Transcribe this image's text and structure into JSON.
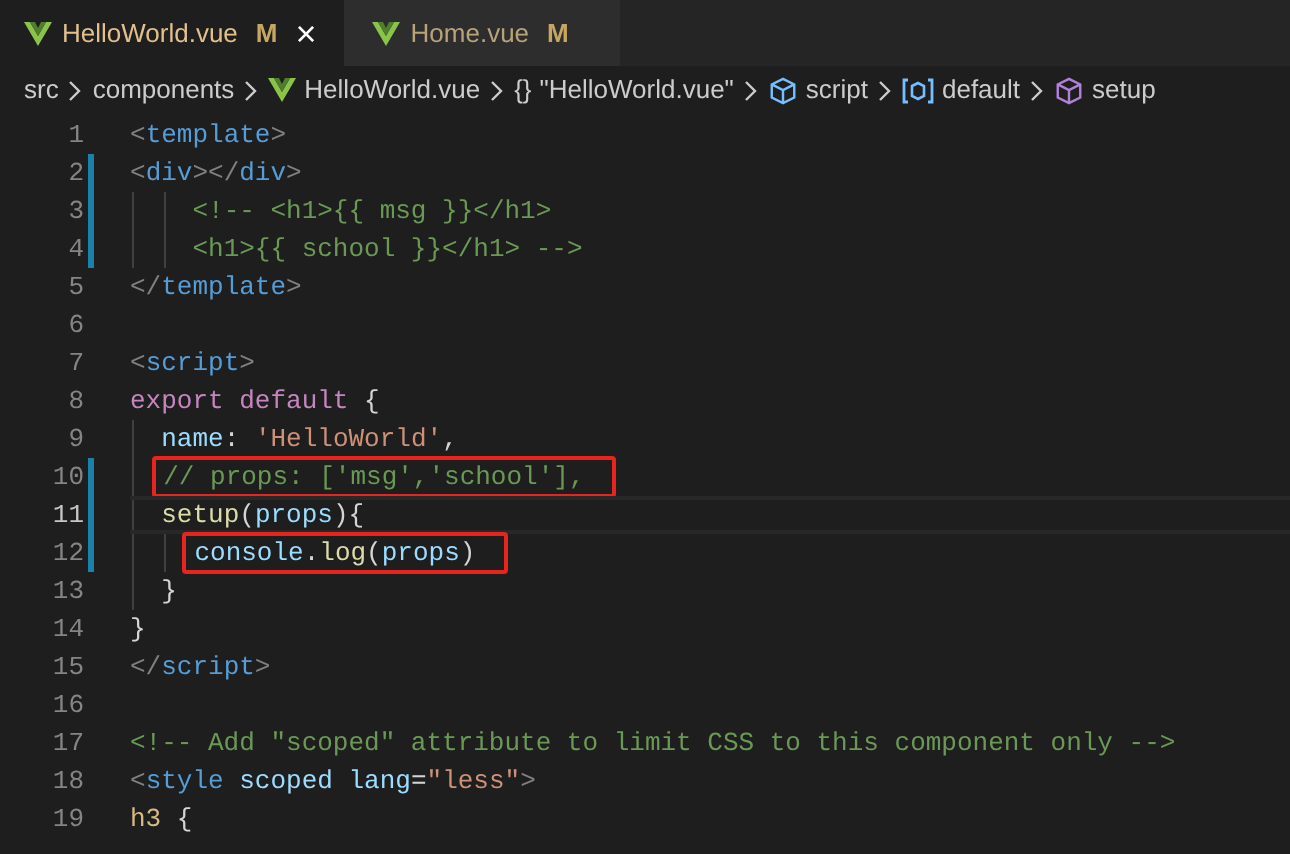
{
  "tabs": [
    {
      "label": "HelloWorld.vue",
      "badge": "M",
      "selected": true,
      "close": "×"
    },
    {
      "label": "Home.vue",
      "badge": "M",
      "selected": false
    }
  ],
  "breadcrumb": [
    {
      "label": "src"
    },
    {
      "label": "components"
    },
    {
      "label": "HelloWorld.vue",
      "kind": "vue"
    },
    {
      "label": "\"HelloWorld.vue\"",
      "kind": "braces",
      "glyph": "{}"
    },
    {
      "label": "script",
      "kind": "module"
    },
    {
      "label": "default",
      "kind": "field"
    },
    {
      "label": "setup",
      "kind": "method"
    }
  ],
  "editor": {
    "lines": [
      {
        "number": "1",
        "modified": false,
        "current": false,
        "boxed": false,
        "tokens": [
          {
            "text": "<",
            "kind": "punct"
          },
          {
            "text": "template",
            "kind": "tag"
          },
          {
            "text": ">",
            "kind": "punct"
          }
        ]
      },
      {
        "number": "2",
        "modified": true,
        "current": false,
        "boxed": false,
        "tokens": [
          {
            "text": "<",
            "kind": "punct"
          },
          {
            "text": "div",
            "kind": "tag"
          },
          {
            "text": "></",
            "kind": "punct"
          },
          {
            "text": "div",
            "kind": "tag"
          },
          {
            "text": ">",
            "kind": "punct"
          }
        ]
      },
      {
        "number": "3",
        "modified": true,
        "current": false,
        "boxed": false,
        "tokens": [
          {
            "text": "    <!-- <h1>{{ msg }}</h1>",
            "kind": "comment"
          }
        ]
      },
      {
        "number": "4",
        "modified": true,
        "current": false,
        "boxed": false,
        "tokens": [
          {
            "text": "    <h1>{{ school }}</h1> -->",
            "kind": "comment"
          }
        ]
      },
      {
        "number": "5",
        "modified": false,
        "current": false,
        "boxed": false,
        "tokens": [
          {
            "text": "</",
            "kind": "punct"
          },
          {
            "text": "template",
            "kind": "tag"
          },
          {
            "text": ">",
            "kind": "punct"
          }
        ]
      },
      {
        "number": "6",
        "modified": false,
        "current": false,
        "boxed": false
      },
      {
        "number": "7",
        "modified": false,
        "current": false,
        "boxed": false,
        "tokens": [
          {
            "text": "<",
            "kind": "punct"
          },
          {
            "text": "script",
            "kind": "tag"
          },
          {
            "text": ">",
            "kind": "punct"
          }
        ]
      },
      {
        "number": "8",
        "modified": false,
        "current": false,
        "boxed": false,
        "tokens": [
          {
            "text": "export ",
            "kind": "keyword"
          },
          {
            "text": "default",
            "kind": "keyword"
          },
          {
            "text": " {",
            "kind": "plain"
          }
        ]
      },
      {
        "number": "9",
        "modified": false,
        "current": false,
        "boxed": false,
        "tokens": [
          {
            "text": "  name",
            "kind": "variable"
          },
          {
            "text": ": ",
            "kind": "plain"
          },
          {
            "text": "'HelloWorld'",
            "kind": "string"
          },
          {
            "text": ",",
            "kind": "plain"
          }
        ]
      },
      {
        "number": "10",
        "modified": true,
        "current": false,
        "boxed": true,
        "tokens": [
          {
            "text": "  // props: ['msg','school'],",
            "kind": "comment"
          }
        ]
      },
      {
        "number": "11",
        "modified": true,
        "current": true,
        "boxed": false,
        "tokens": [
          {
            "text": "  setup",
            "kind": "function"
          },
          {
            "text": "(",
            "kind": "plain"
          },
          {
            "text": "props",
            "kind": "variable"
          },
          {
            "text": "){",
            "kind": "plain"
          }
        ]
      },
      {
        "number": "12",
        "modified": true,
        "current": false,
        "boxed": true,
        "tokens": [
          {
            "text": "    console",
            "kind": "variable"
          },
          {
            "text": ".",
            "kind": "plain"
          },
          {
            "text": "log",
            "kind": "function"
          },
          {
            "text": "(",
            "kind": "plain"
          },
          {
            "text": "props",
            "kind": "variable"
          },
          {
            "text": ")",
            "kind": "plain"
          }
        ]
      },
      {
        "number": "13",
        "modified": false,
        "current": false,
        "boxed": false,
        "tokens": [
          {
            "text": "  }",
            "kind": "plain"
          }
        ]
      },
      {
        "number": "14",
        "modified": false,
        "current": false,
        "boxed": false,
        "tokens": [
          {
            "text": "}",
            "kind": "plain"
          }
        ]
      },
      {
        "number": "15",
        "modified": false,
        "current": false,
        "boxed": false,
        "tokens": [
          {
            "text": "</",
            "kind": "punct"
          },
          {
            "text": "script",
            "kind": "tag"
          },
          {
            "text": ">",
            "kind": "punct"
          }
        ]
      },
      {
        "number": "16",
        "modified": false,
        "current": false,
        "boxed": false
      },
      {
        "number": "17",
        "modified": false,
        "current": false,
        "boxed": false,
        "tokens": [
          {
            "text": "<!-- Add \"scoped\" attribute to limit CSS to this component only -->",
            "kind": "comment"
          }
        ]
      },
      {
        "number": "18",
        "modified": false,
        "current": false,
        "boxed": false,
        "tokens": [
          {
            "text": "<",
            "kind": "punct"
          },
          {
            "text": "style ",
            "kind": "tag"
          },
          {
            "text": "scoped ",
            "kind": "attr"
          },
          {
            "text": "lang",
            "kind": "attr"
          },
          {
            "text": "=",
            "kind": "plain"
          },
          {
            "text": "\"less\"",
            "kind": "string"
          },
          {
            "text": ">",
            "kind": "punct"
          }
        ]
      },
      {
        "number": "19",
        "modified": false,
        "current": false,
        "boxed": false,
        "tokens": [
          {
            "text": "h3",
            "kind": "selector"
          },
          {
            "text": " {",
            "kind": "plain"
          }
        ]
      }
    ]
  }
}
